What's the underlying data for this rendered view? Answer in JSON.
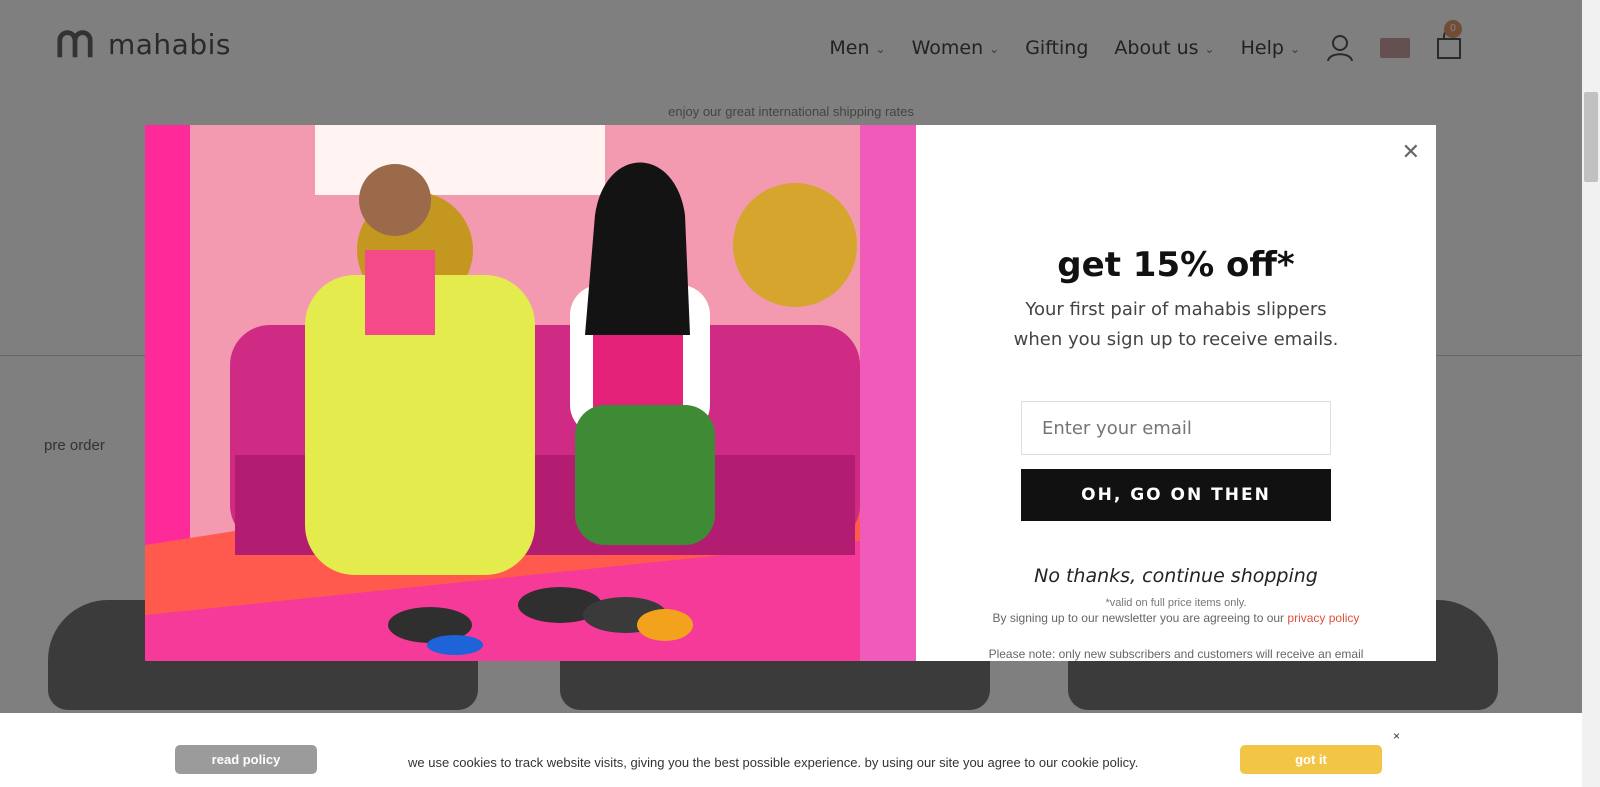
{
  "site": {
    "logo_text": "mahabis",
    "nav": [
      {
        "label": "Men"
      },
      {
        "label": "Women"
      },
      {
        "label": "Gifting"
      },
      {
        "label": "About us"
      },
      {
        "label": "Help"
      }
    ],
    "cart_count": "0"
  },
  "background": {
    "shipping_note": "enjoy our great international shipping rates",
    "pre_order": "pre order"
  },
  "popup": {
    "headline": "get 15% off*",
    "subline": "Your first pair of mahabis slippers when you sign up to receive emails.",
    "email_placeholder": "Enter your email",
    "cta_label": "OH, GO ON THEN",
    "no_thanks": "No thanks, continue shopping",
    "valid_note": "*valid on full price items only.",
    "privacy_text": "By signing up to our newsletter you are agreeing to our",
    "privacy_link": "privacy policy",
    "subscriber_note": "Please note: only new subscribers and customers will receive an email"
  },
  "cookie_bar": {
    "read_policy": "read policy",
    "message": "we use cookies to track website visits, giving you the best possible experience. by using our site you agree to our cookie policy.",
    "got_it": "got it",
    "close": "×"
  }
}
